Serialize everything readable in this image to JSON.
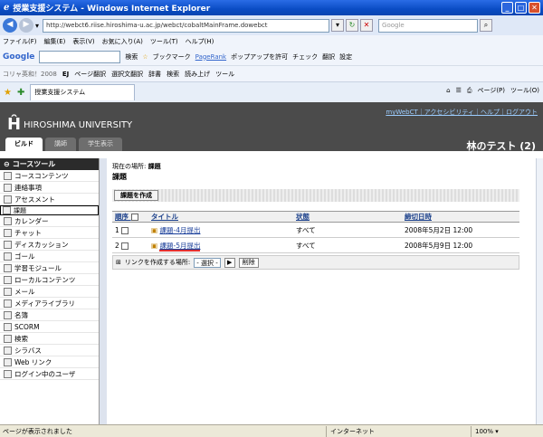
{
  "window": {
    "title": "授業支援システム - Windows Internet Explorer"
  },
  "address": {
    "url": "http://webct6.riise.hiroshima-u.ac.jp/webct/cobaltMainFrame.dowebct",
    "search_placeholder": "Google"
  },
  "menu": [
    "ファイル(F)",
    "編集(E)",
    "表示(V)",
    "お気に入り(A)",
    "ツール(T)",
    "ヘルプ(H)"
  ],
  "google_toolbar": {
    "logo": "Google",
    "search": "検索",
    "bookmark": "ブックマーク",
    "pagerank": "PageRank",
    "popup": "ポップアップを許可",
    "check": "チェック",
    "translate": "翻訳",
    "settings": "設定"
  },
  "word_toolbar": {
    "label": "コリャ英和！2008",
    "tool1": "EJ",
    "page_translate": "ページ翻訳",
    "sel_translate": "選択文翻訳",
    "dict": "辞書",
    "search": "検索",
    "read": "読み上げ",
    "tools": "ツール"
  },
  "browser_tab": {
    "title": "授業支援システム"
  },
  "tab_tools": {
    "page": "ページ(P)",
    "tools": "ツール(O)"
  },
  "banner": {
    "logo": "Ĥ",
    "university": "HIROSHIMA UNIVERSITY",
    "links": "myWebCT｜アクセシビリティ｜ヘルプ｜ログアウト",
    "course": "林のテスト (2)",
    "tabs": [
      "ビルド",
      "講師",
      "学生表示"
    ]
  },
  "sidebar": {
    "header": "コースツール",
    "items": [
      "コースコンテンツ",
      "連絡事項",
      "アセスメント",
      "課題",
      "カレンダー",
      "チャット",
      "ディスカッション",
      "ゴール",
      "学習モジュール",
      "ローカルコンテンツ",
      "メール",
      "メディアライブラリ",
      "名簿",
      "SCORM",
      "検索",
      "シラバス",
      "Web リンク",
      "ログイン中のユーザ"
    ]
  },
  "main": {
    "location_label": "現在の場所:",
    "location": "課題",
    "title": "課題",
    "create_button": "課題を作成",
    "columns": [
      "順序",
      "タイトル",
      "状態",
      "締切日時"
    ],
    "rows": [
      {
        "order": "1",
        "title": "課題-4月提出",
        "status": "すべて",
        "due": "2008年5月2日 12:00"
      },
      {
        "order": "2",
        "title": "課題-5月提出",
        "status": "すべて",
        "due": "2008年5月9日 12:00"
      }
    ],
    "link_label": "リンクを作成する場所:",
    "link_select": "- 選択 -",
    "delete": "削除"
  },
  "status": {
    "left": "ページが表示されました",
    "zone": "インターネット",
    "zoom": "100%"
  }
}
